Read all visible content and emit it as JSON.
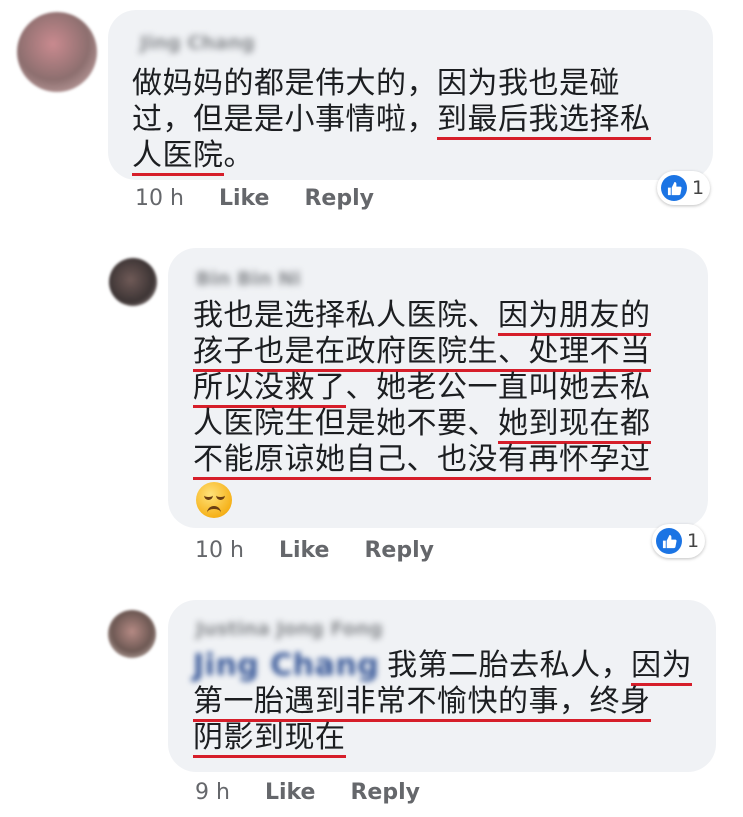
{
  "comments": [
    {
      "author": "Jing Chang",
      "lines": [
        [
          {
            "t": "做妈妈的都是伟大的，因为我也是碰"
          }
        ],
        [
          {
            "t": "过，但是是小事情啦，"
          },
          {
            "t": "到最后我选择私",
            "u": true
          }
        ],
        [
          {
            "t": "人医院",
            "u": true
          },
          {
            "t": "。"
          }
        ]
      ],
      "time": "10 h",
      "like": "Like",
      "reply": "Reply",
      "reaction_count": "1"
    },
    {
      "author": "Bin Bin Ni",
      "lines": [
        [
          {
            "t": "我也是选择私人医院、"
          },
          {
            "t": "因为朋友的",
            "u": true
          }
        ],
        [
          {
            "t": "孩子也是在政府医院生、处理不当",
            "u": true
          }
        ],
        [
          {
            "t": "所以没救了",
            "u": true
          },
          {
            "t": "、她老公一直叫她去私"
          }
        ],
        [
          {
            "t": "人医院生但是她不要、"
          },
          {
            "t": "她到现在都",
            "u": true
          }
        ],
        [
          {
            "t": "不能原谅她自己、也没有再怀孕过",
            "u": true
          }
        ]
      ],
      "emoji": "sad-face-emoji",
      "time": "10 h",
      "like": "Like",
      "reply": "Reply",
      "reaction_count": "1"
    },
    {
      "author": "Justina Jong Fong",
      "mention": "Jing Chang",
      "lines": [
        [
          {
            "t": "我第二胎去私人，"
          },
          {
            "t": "因为",
            "u": true
          }
        ],
        [
          {
            "t": "第一胎遇到非常不愉快的事，终身",
            "u": true
          }
        ],
        [
          {
            "t": "阴影到现在",
            "u": true
          }
        ]
      ],
      "time": "9 h",
      "like": "Like",
      "reply": "Reply"
    }
  ],
  "colors": {
    "underline": "#d61e2a",
    "bubble": "#f0f2f5",
    "like_blue": "#1b74e4"
  }
}
